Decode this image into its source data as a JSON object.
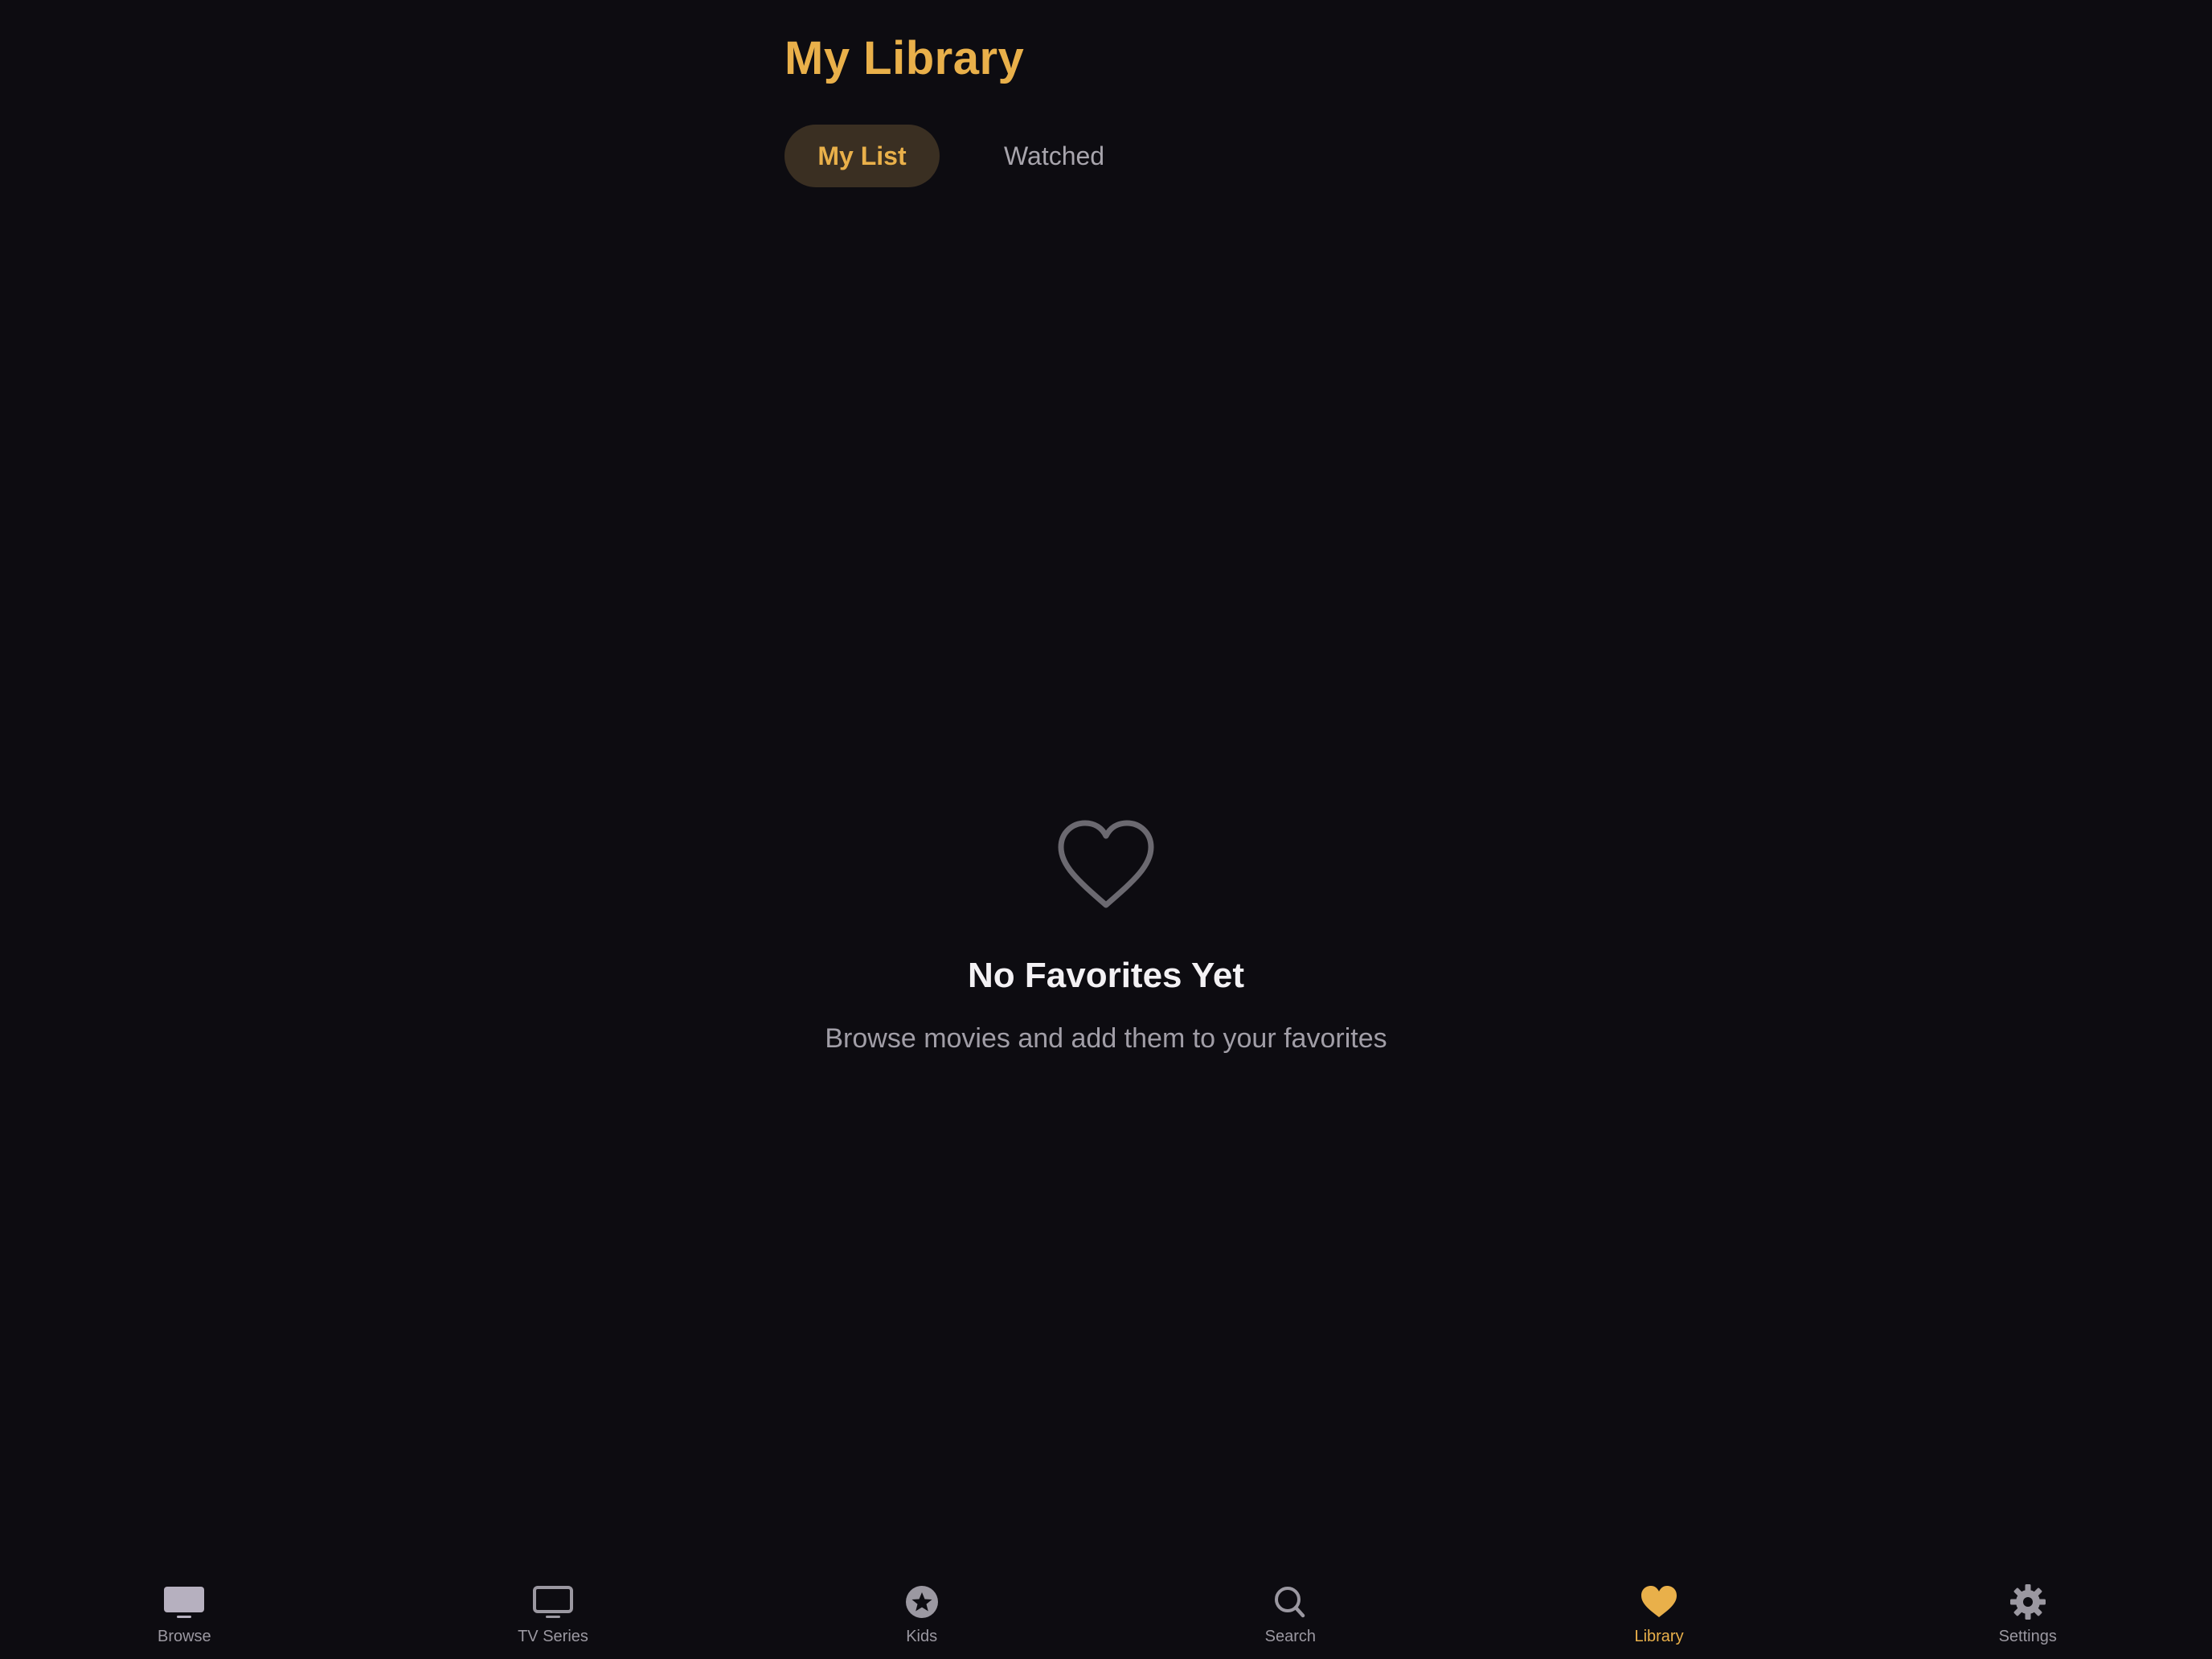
{
  "header": {
    "title": "My Library"
  },
  "segments": [
    {
      "label": "My List",
      "selected": true
    },
    {
      "label": "Watched",
      "selected": false
    }
  ],
  "empty_state": {
    "icon": "heart-outline-icon",
    "title": "No Favorites Yet",
    "subtitle": "Browse movies and add them to your favorites"
  },
  "tabbar": {
    "items": [
      {
        "label": "Browse",
        "icon": "tv-filled-icon",
        "active": false
      },
      {
        "label": "TV Series",
        "icon": "tv-outline-icon",
        "active": false
      },
      {
        "label": "Kids",
        "icon": "star-circle-icon",
        "active": false
      },
      {
        "label": "Search",
        "icon": "search-icon",
        "active": false
      },
      {
        "label": "Library",
        "icon": "heart-icon",
        "active": true
      },
      {
        "label": "Settings",
        "icon": "gear-icon",
        "active": false
      }
    ]
  },
  "colors": {
    "background": "#0d0c11",
    "accent": "#e9b04a",
    "segment_active_bg": "#3a2f22",
    "inactive_icon": "#9b98a1",
    "muted_text": "#a19ea7"
  }
}
